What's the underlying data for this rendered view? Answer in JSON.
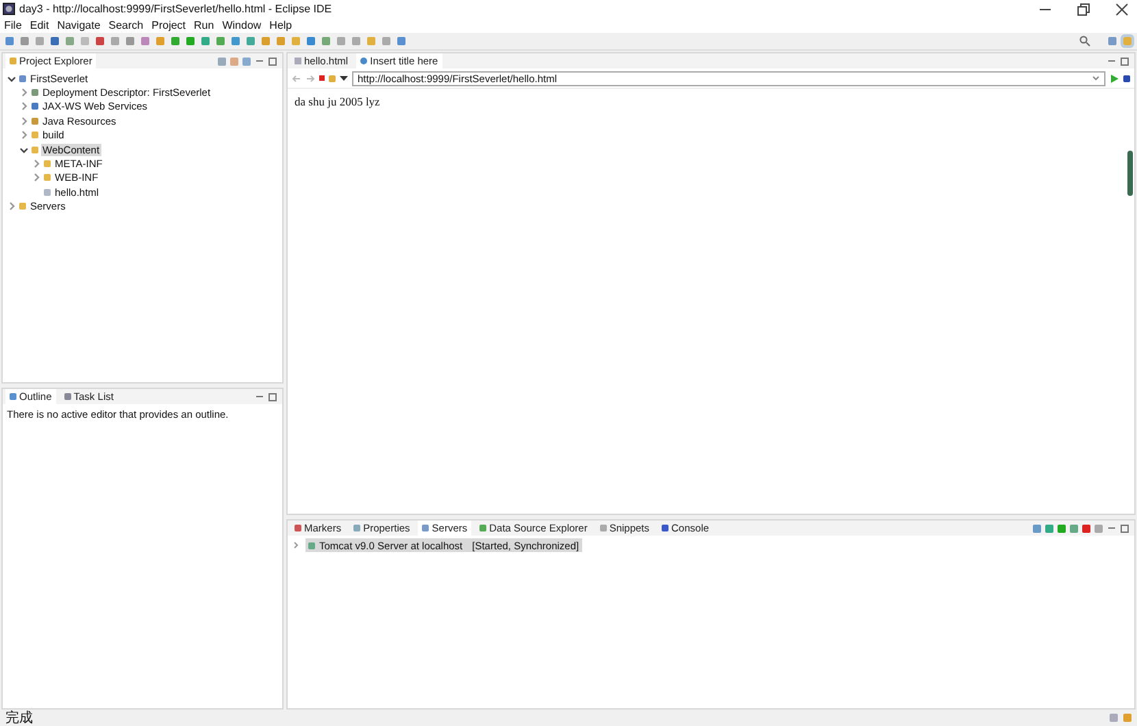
{
  "window": {
    "title": "day3 - http://localhost:9999/FirstSeverlet/hello.html - Eclipse IDE"
  },
  "menu": [
    "File",
    "Edit",
    "Navigate",
    "Search",
    "Project",
    "Run",
    "Window",
    "Help"
  ],
  "project_explorer": {
    "title": "Project Explorer",
    "tree": [
      {
        "label": "FirstSeverlet",
        "kind": "project",
        "expanded": true,
        "selected": false,
        "children": [
          {
            "label": "Deployment Descriptor: FirstSeverlet",
            "kind": "descriptor",
            "expanded": false,
            "selected": false
          },
          {
            "label": "JAX-WS Web Services",
            "kind": "services",
            "expanded": false,
            "selected": false
          },
          {
            "label": "Java Resources",
            "kind": "resources",
            "expanded": false,
            "selected": false
          },
          {
            "label": "build",
            "kind": "folder",
            "expanded": false,
            "selected": false
          },
          {
            "label": "WebContent",
            "kind": "folder",
            "expanded": true,
            "selected": true,
            "children": [
              {
                "label": "META-INF",
                "kind": "folder",
                "expanded": false,
                "selected": false
              },
              {
                "label": "WEB-INF",
                "kind": "folder",
                "expanded": false,
                "selected": false
              },
              {
                "label": "hello.html",
                "kind": "file",
                "selected": false
              }
            ]
          }
        ]
      },
      {
        "label": "Servers",
        "kind": "folder",
        "expanded": false,
        "selected": false
      }
    ]
  },
  "outline_tabs": [
    {
      "label": "Outline",
      "selected": true
    },
    {
      "label": "Task List",
      "selected": false
    }
  ],
  "outline_message": "There is no active editor that provides an outline.",
  "editor_tabs": [
    {
      "label": "hello.html",
      "selected": false
    },
    {
      "label": "Insert title here",
      "selected": true
    }
  ],
  "browser": {
    "url": "http://localhost:9999/FirstSeverlet/hello.html",
    "content": "da shu ju 2005 lyz"
  },
  "bottom_tabs": [
    {
      "label": "Markers",
      "selected": false
    },
    {
      "label": "Properties",
      "selected": false
    },
    {
      "label": "Servers",
      "selected": true
    },
    {
      "label": "Data Source Explorer",
      "selected": false
    },
    {
      "label": "Snippets",
      "selected": false
    },
    {
      "label": "Console",
      "selected": false
    }
  ],
  "servers": [
    {
      "name": "Tomcat v9.0 Server at localhost",
      "status": "[Started, Synchronized]",
      "selected": true
    }
  ],
  "status_bar": {
    "text": "完成"
  }
}
